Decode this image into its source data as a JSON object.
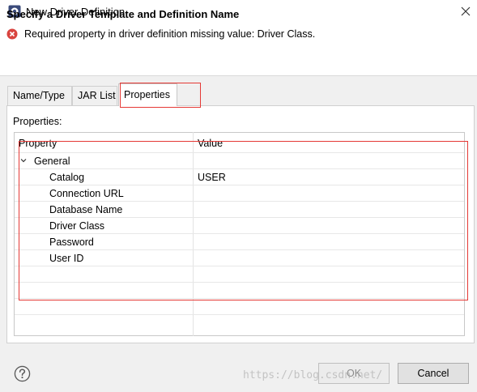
{
  "window": {
    "title": "New Driver Definition"
  },
  "banner": {
    "title": "Specify a Driver Template and Definition Name",
    "error_message": "Required property in driver definition missing value: Driver Class."
  },
  "tabs": [
    {
      "label": "Name/Type",
      "selected": false
    },
    {
      "label": "JAR List",
      "selected": false
    },
    {
      "label": "Properties",
      "selected": true
    }
  ],
  "properties_panel": {
    "label": "Properties:",
    "columns": [
      "Property",
      "Value"
    ],
    "group": {
      "label": "General",
      "expanded": true
    },
    "rows": [
      {
        "property": "Catalog",
        "value": "USER"
      },
      {
        "property": "Connection URL",
        "value": ""
      },
      {
        "property": "Database Name",
        "value": ""
      },
      {
        "property": "Driver Class",
        "value": ""
      },
      {
        "property": "Password",
        "value": ""
      },
      {
        "property": "User ID",
        "value": ""
      }
    ]
  },
  "footer": {
    "help_icon": "question-mark-icon",
    "ok_label": "OK",
    "ok_enabled": false,
    "cancel_label": "Cancel"
  },
  "watermark": "https://blog.csdn.net/",
  "colors": {
    "annotation_red": "#e53935",
    "error_red": "#d9443f"
  }
}
